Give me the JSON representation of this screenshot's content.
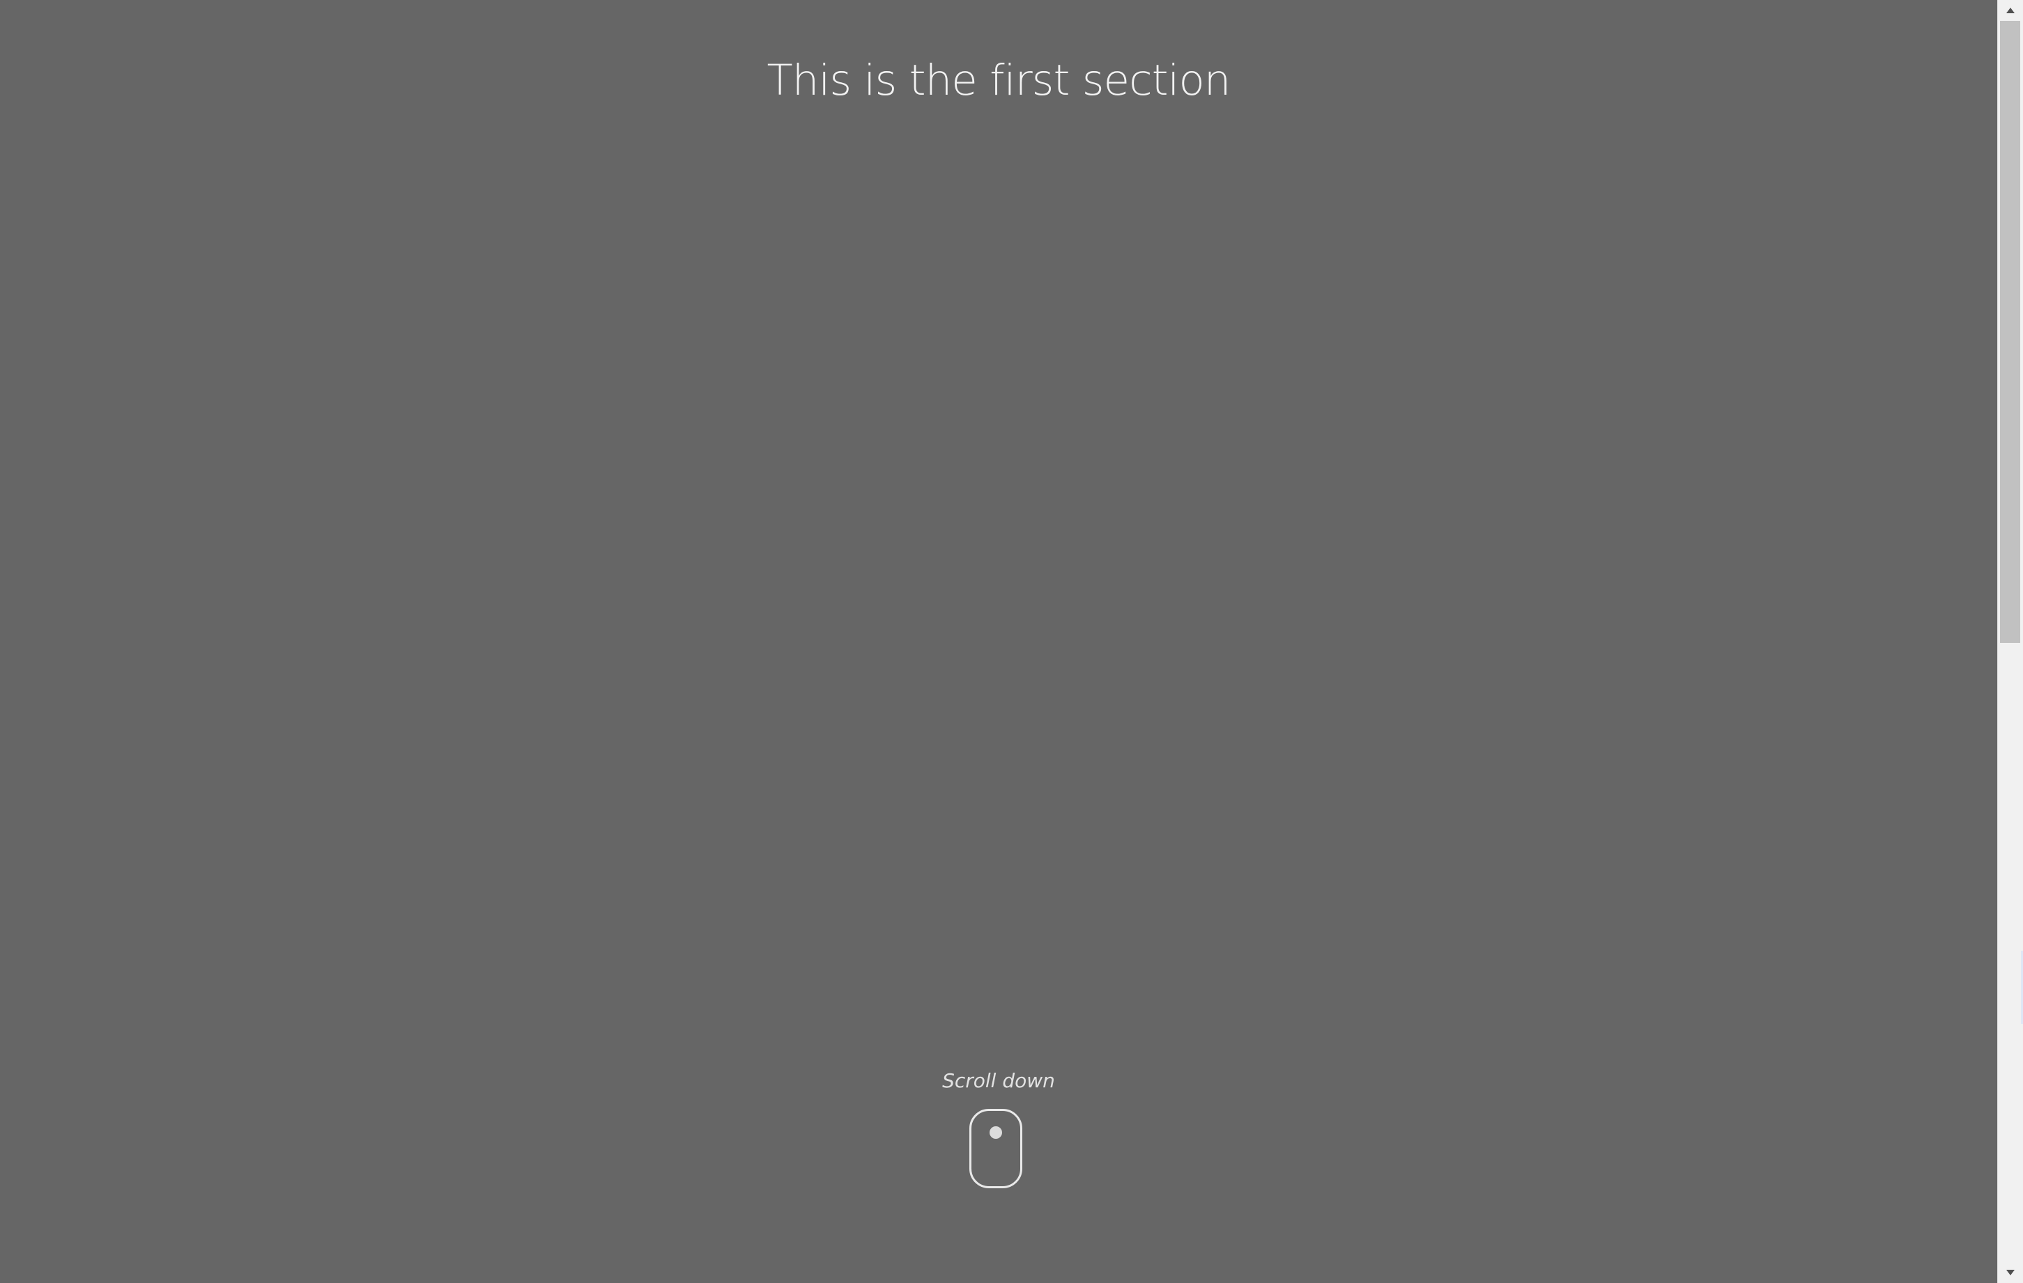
{
  "section": {
    "title": "This is the first section",
    "scroll_hint": "Scroll down",
    "background_color": "#666666"
  },
  "icons": {
    "mouse": "mouse-scroll-icon",
    "scroll_up": "triangle-up-icon",
    "scroll_down": "triangle-down-icon"
  },
  "scrollbar": {
    "position_fraction": 0.0,
    "visible_fraction": 0.5
  }
}
